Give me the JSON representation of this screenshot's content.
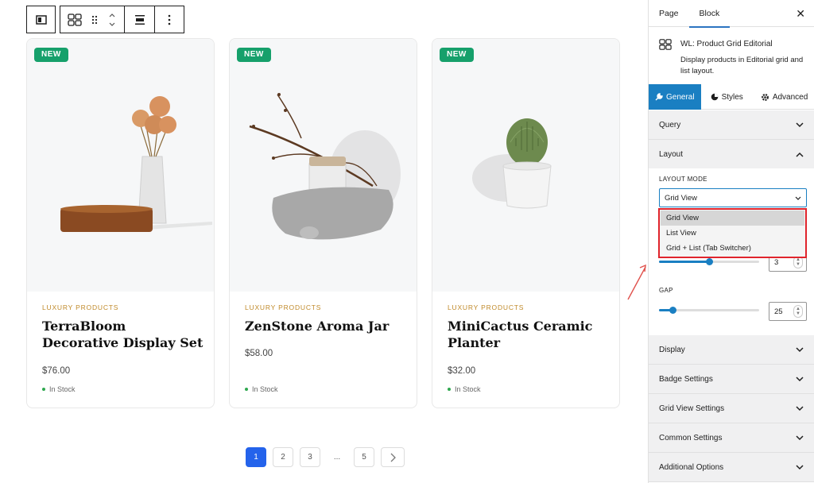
{
  "toolbar": {
    "items": [
      "block-type",
      "grid-layout",
      "drag-handle",
      "move-up-down",
      "align",
      "more-options"
    ]
  },
  "products": [
    {
      "badge": "NEW",
      "category": "LUXURY PRODUCTS",
      "title": "TerraBloom Decorative Display Set",
      "price": "$76.00",
      "stock": "In Stock"
    },
    {
      "badge": "NEW",
      "category": "LUXURY PRODUCTS",
      "title": "ZenStone Aroma Jar",
      "price": "$58.00",
      "stock": "In Stock"
    },
    {
      "badge": "NEW",
      "category": "LUXURY PRODUCTS",
      "title": "MiniCactus Ceramic Planter",
      "price": "$32.00",
      "stock": "In Stock"
    }
  ],
  "pagination": {
    "pages": [
      "1",
      "2",
      "3"
    ],
    "ellipsis": "...",
    "last": "5",
    "current": "1"
  },
  "sidebar": {
    "tabs": [
      "Page",
      "Block"
    ],
    "active_tab": "Block",
    "close": "✕",
    "block_name": "WL: Product Grid Editorial",
    "block_desc": "Display products in Editorial grid and list layout.",
    "panel_tabs": [
      "General",
      "Styles",
      "Advanced"
    ],
    "panels": {
      "query": "Query",
      "layout": "Layout",
      "display": "Display",
      "badge": "Badge Settings",
      "grid_view": "Grid View Settings",
      "common": "Common Settings",
      "additional": "Additional Options"
    },
    "layout_mode_label": "LAYOUT MODE",
    "layout_mode_value": "Grid View",
    "layout_options": [
      "Grid View",
      "List View",
      "Grid + List (Tab Switcher)"
    ],
    "columns_value": "3",
    "gap_label": "GAP",
    "gap_value": "25"
  },
  "colors": {
    "accent": "#1a7fc2",
    "badge": "#16a06b",
    "category": "#c08a2a",
    "highlight": "#e0242c",
    "page_active": "#2463eb"
  }
}
